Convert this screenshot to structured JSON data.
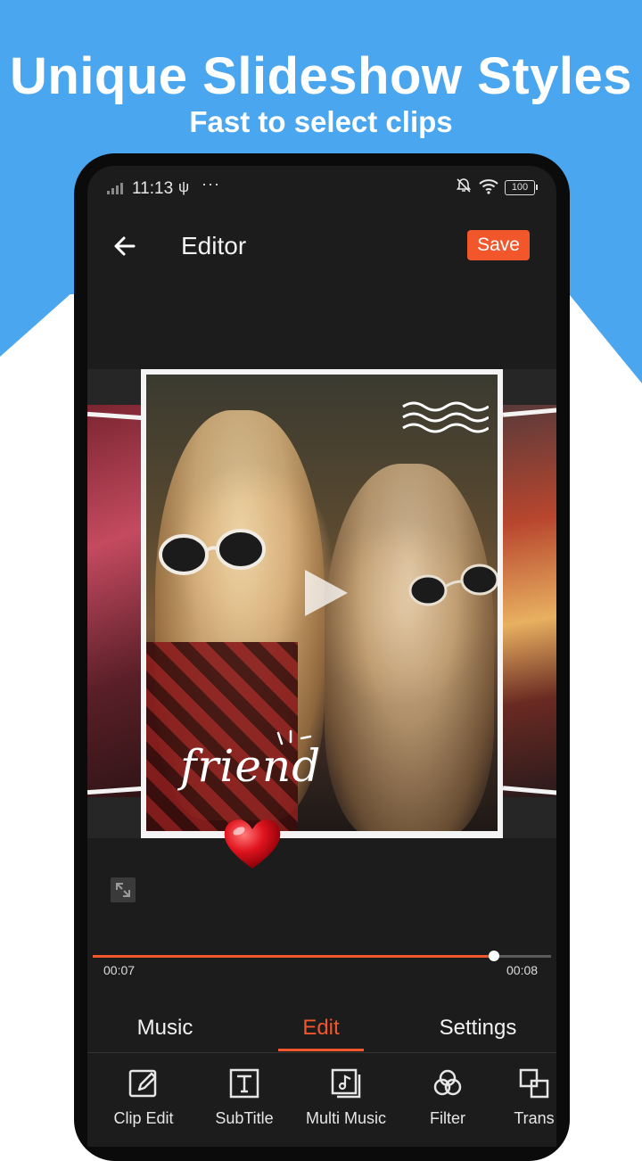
{
  "promo": {
    "headline": "Unique Slideshow Styles",
    "subline": "Fast to select clips"
  },
  "status_bar": {
    "time": "11:13",
    "usb_glyph": "ψ",
    "more": "···",
    "battery": "100"
  },
  "app_bar": {
    "title": "Editor",
    "save_label": "Save"
  },
  "preview": {
    "overlay_text": "friend"
  },
  "playback": {
    "current_time": "00:07",
    "end_time": "00:08",
    "progress_fraction": 0.875
  },
  "tabs": [
    {
      "label": "Music",
      "active": false
    },
    {
      "label": "Edit",
      "active": true
    },
    {
      "label": "Settings",
      "active": false
    }
  ],
  "tools": [
    {
      "label": "Clip Edit",
      "icon": "edit-icon"
    },
    {
      "label": "SubTitle",
      "icon": "text-icon"
    },
    {
      "label": "Multi Music",
      "icon": "music-icon"
    },
    {
      "label": "Filter",
      "icon": "filter-icon"
    },
    {
      "label": "Trans",
      "icon": "transition-icon"
    }
  ],
  "colors": {
    "accent": "#f2572c",
    "promo_blue": "#4aa7ef",
    "screen_bg": "#1c1c1c"
  }
}
